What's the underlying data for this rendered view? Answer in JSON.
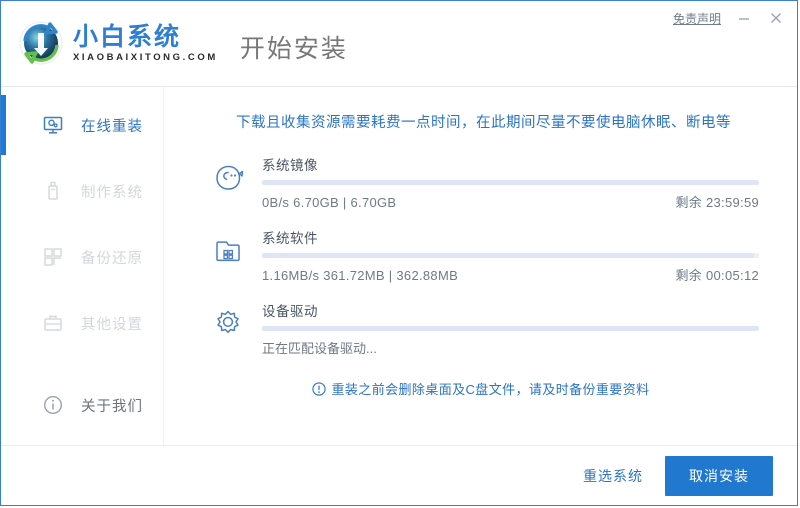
{
  "window": {
    "disclaimer_label": "免责声明",
    "minimize_label": "—",
    "close_label": "✕"
  },
  "brand": {
    "name_cn": "小白系统",
    "name_en": "XIAOBAIXITONG.COM",
    "logo_icon": "recycle-globe-icon"
  },
  "header": {
    "title": "开始安装"
  },
  "sidebar": {
    "items": [
      {
        "label": "在线重装",
        "icon": "monitor-icon",
        "state": "active"
      },
      {
        "label": "制作系统",
        "icon": "usb-drive-icon",
        "state": "disabled"
      },
      {
        "label": "备份还原",
        "icon": "grid-restore-icon",
        "state": "disabled"
      },
      {
        "label": "其他设置",
        "icon": "toolbox-icon",
        "state": "disabled"
      },
      {
        "label": "关于我们",
        "icon": "info-circle-icon",
        "state": "normal"
      }
    ]
  },
  "main": {
    "top_notice": "下载且收集资源需要耗费一点时间，在此期间尽量不要使电脑休眠、断电等",
    "tasks": [
      {
        "title": "系统镜像",
        "icon": "system-image-icon",
        "stats": "0B/s 6.70GB | 6.70GB",
        "remaining": "剩余 23:59:59",
        "progress_percent": 100
      },
      {
        "title": "系统软件",
        "icon": "folder-apps-icon",
        "stats": "1.16MB/s 361.72MB | 362.88MB",
        "remaining": "剩余 00:05:12",
        "progress_percent": 99
      },
      {
        "title": "设备驱动",
        "icon": "gear-icon",
        "status": "正在匹配设备驱动...",
        "progress_percent": 100
      }
    ],
    "bottom_notice": {
      "icon": "exclamation-circle-icon",
      "text": "重装之前会删除桌面及C盘文件，请及时备份重要资料"
    }
  },
  "footer": {
    "reselect_label": "重选系统",
    "cancel_label": "取消安装"
  },
  "colors": {
    "accent": "#2179cf",
    "link": "#2b74c4",
    "progress_track": "#eceffa",
    "progress_fill": "#dfe5f7"
  }
}
